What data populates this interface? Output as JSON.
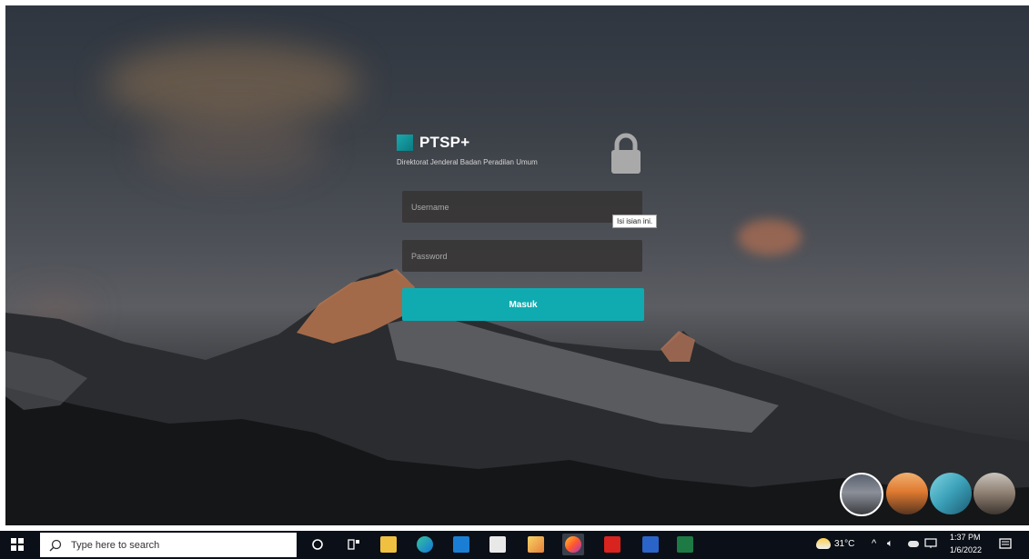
{
  "login": {
    "brand_name": "PTSP+",
    "brand_subtitle": "Direktorat Jenderal Badan Peradilan Umum",
    "username_placeholder": "Username",
    "password_placeholder": "Password",
    "submit_label": "Masuk",
    "tooltip": "Isi isian ini."
  },
  "taskbar": {
    "search_placeholder": "Type here to search",
    "weather": "31°C",
    "time": "1:37 PM",
    "date": "1/6/2022",
    "pinned": [
      "cortana-icon",
      "task-view-icon",
      "file-explorer-icon",
      "edge-icon",
      "mail-icon",
      "store-icon",
      "photos-icon",
      "firefox-icon",
      "acrobat-icon",
      "word-icon",
      "excel-icon"
    ]
  },
  "colors": {
    "accent": "#10abb0",
    "field_bg": "#373434",
    "taskbar_bg": "#0b0f18"
  }
}
